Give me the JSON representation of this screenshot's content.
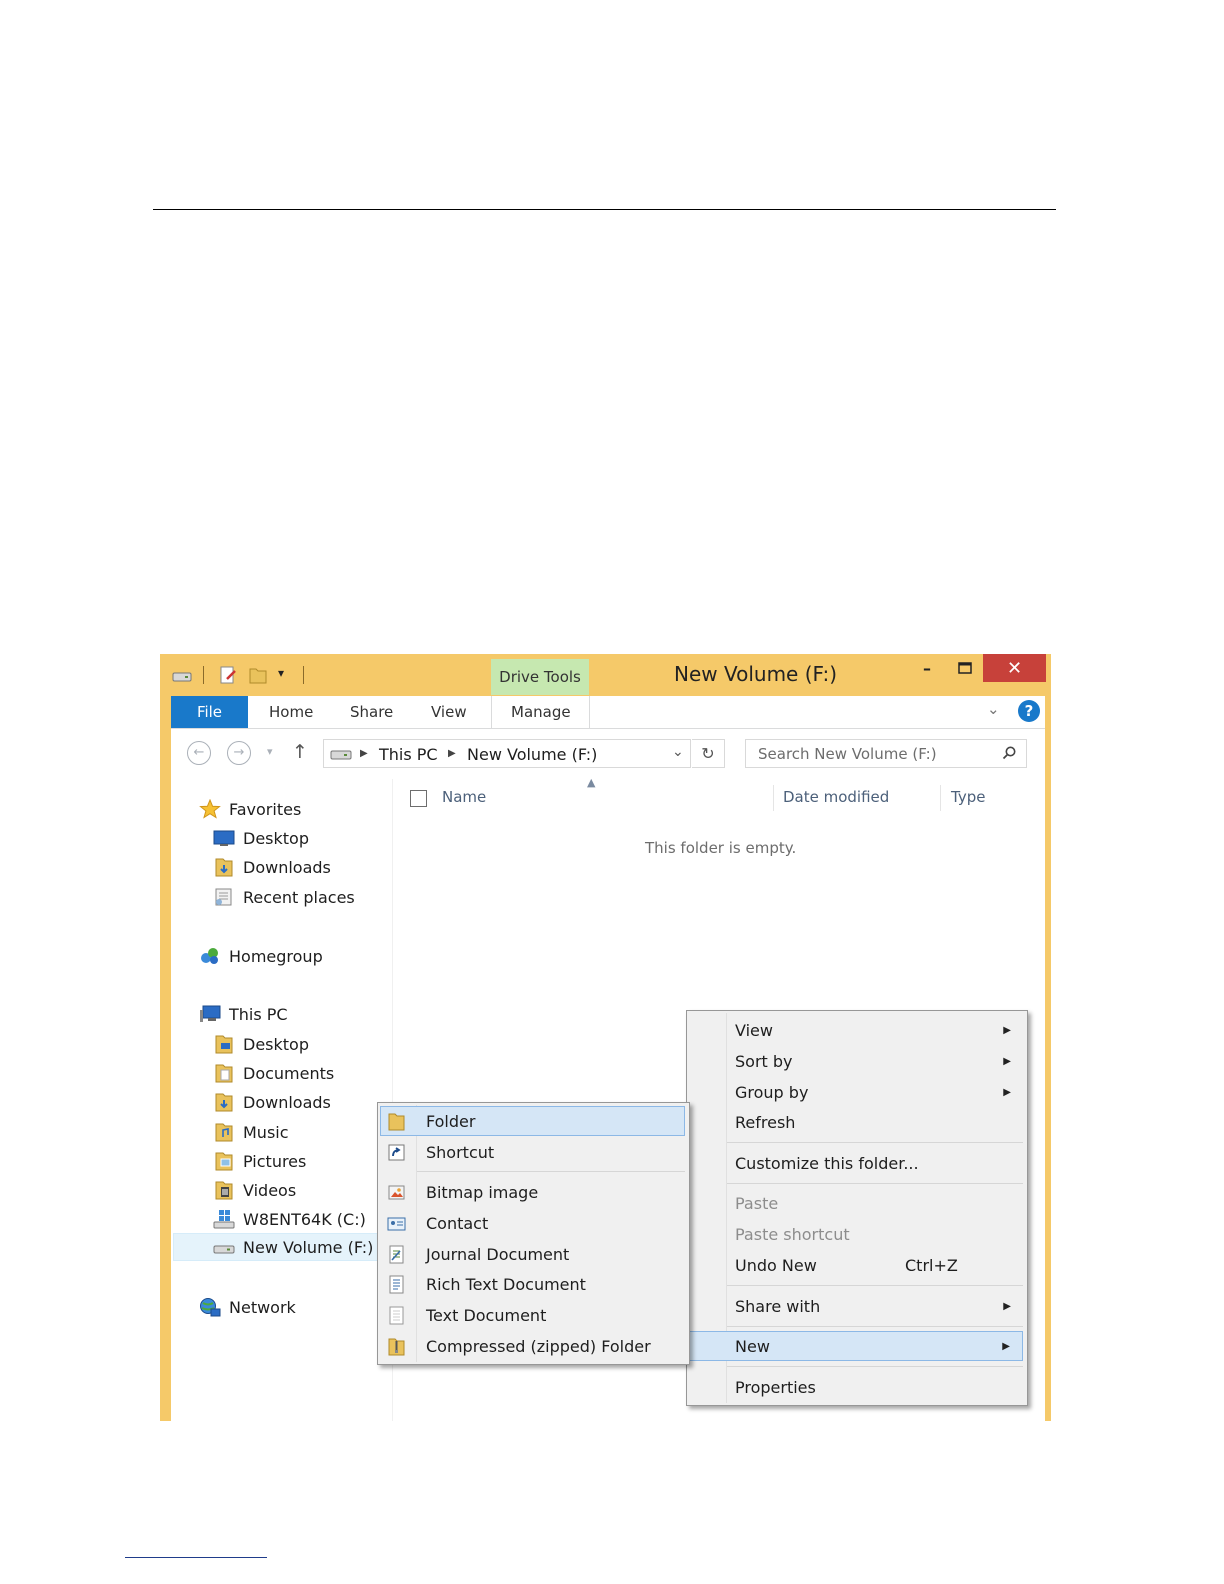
{
  "window": {
    "title": "New Volume (F:)",
    "context_tab": "Drive Tools",
    "close_glyph": "✕",
    "minimize_glyph": "–",
    "maximize_glyph": "□"
  },
  "ribbon": {
    "tabs": [
      "File",
      "Home",
      "Share",
      "View",
      "Manage"
    ],
    "help_glyph": "?"
  },
  "address": {
    "crumbs": [
      "This PC",
      "New Volume (F:)"
    ],
    "search_placeholder": "Search New Volume (F:)"
  },
  "nav_pane": {
    "favorites": {
      "label": "Favorites",
      "items": [
        "Desktop",
        "Downloads",
        "Recent places"
      ]
    },
    "homegroup": "Homegroup",
    "this_pc": {
      "label": "This PC",
      "items": [
        "Desktop",
        "Documents",
        "Downloads",
        "Music",
        "Pictures",
        "Videos",
        "W8ENT64K (C:)",
        "New Volume (F:)"
      ]
    },
    "network": "Network"
  },
  "file_list": {
    "columns": [
      "Name",
      "Date modified",
      "Type"
    ],
    "empty_message": "This folder is empty."
  },
  "context_menu": {
    "items": [
      "View",
      "Sort by",
      "Group by",
      "Refresh",
      "Customize this folder...",
      "Paste",
      "Paste shortcut",
      "Undo New",
      "Share with",
      "New",
      "Properties"
    ],
    "undo_accel": "Ctrl+Z"
  },
  "new_submenu": {
    "items": [
      "Folder",
      "Shortcut",
      "Bitmap image",
      "Contact",
      "Journal Document",
      "Rich Text Document",
      "Text Document",
      "Compressed (zipped) Folder"
    ]
  },
  "colors": {
    "title_bar": "#f5c969",
    "file_tab": "#1979ca",
    "close_button": "#c7413a",
    "context_tab": "#c6e8b0",
    "menu_highlight": "#d5e6f6"
  }
}
